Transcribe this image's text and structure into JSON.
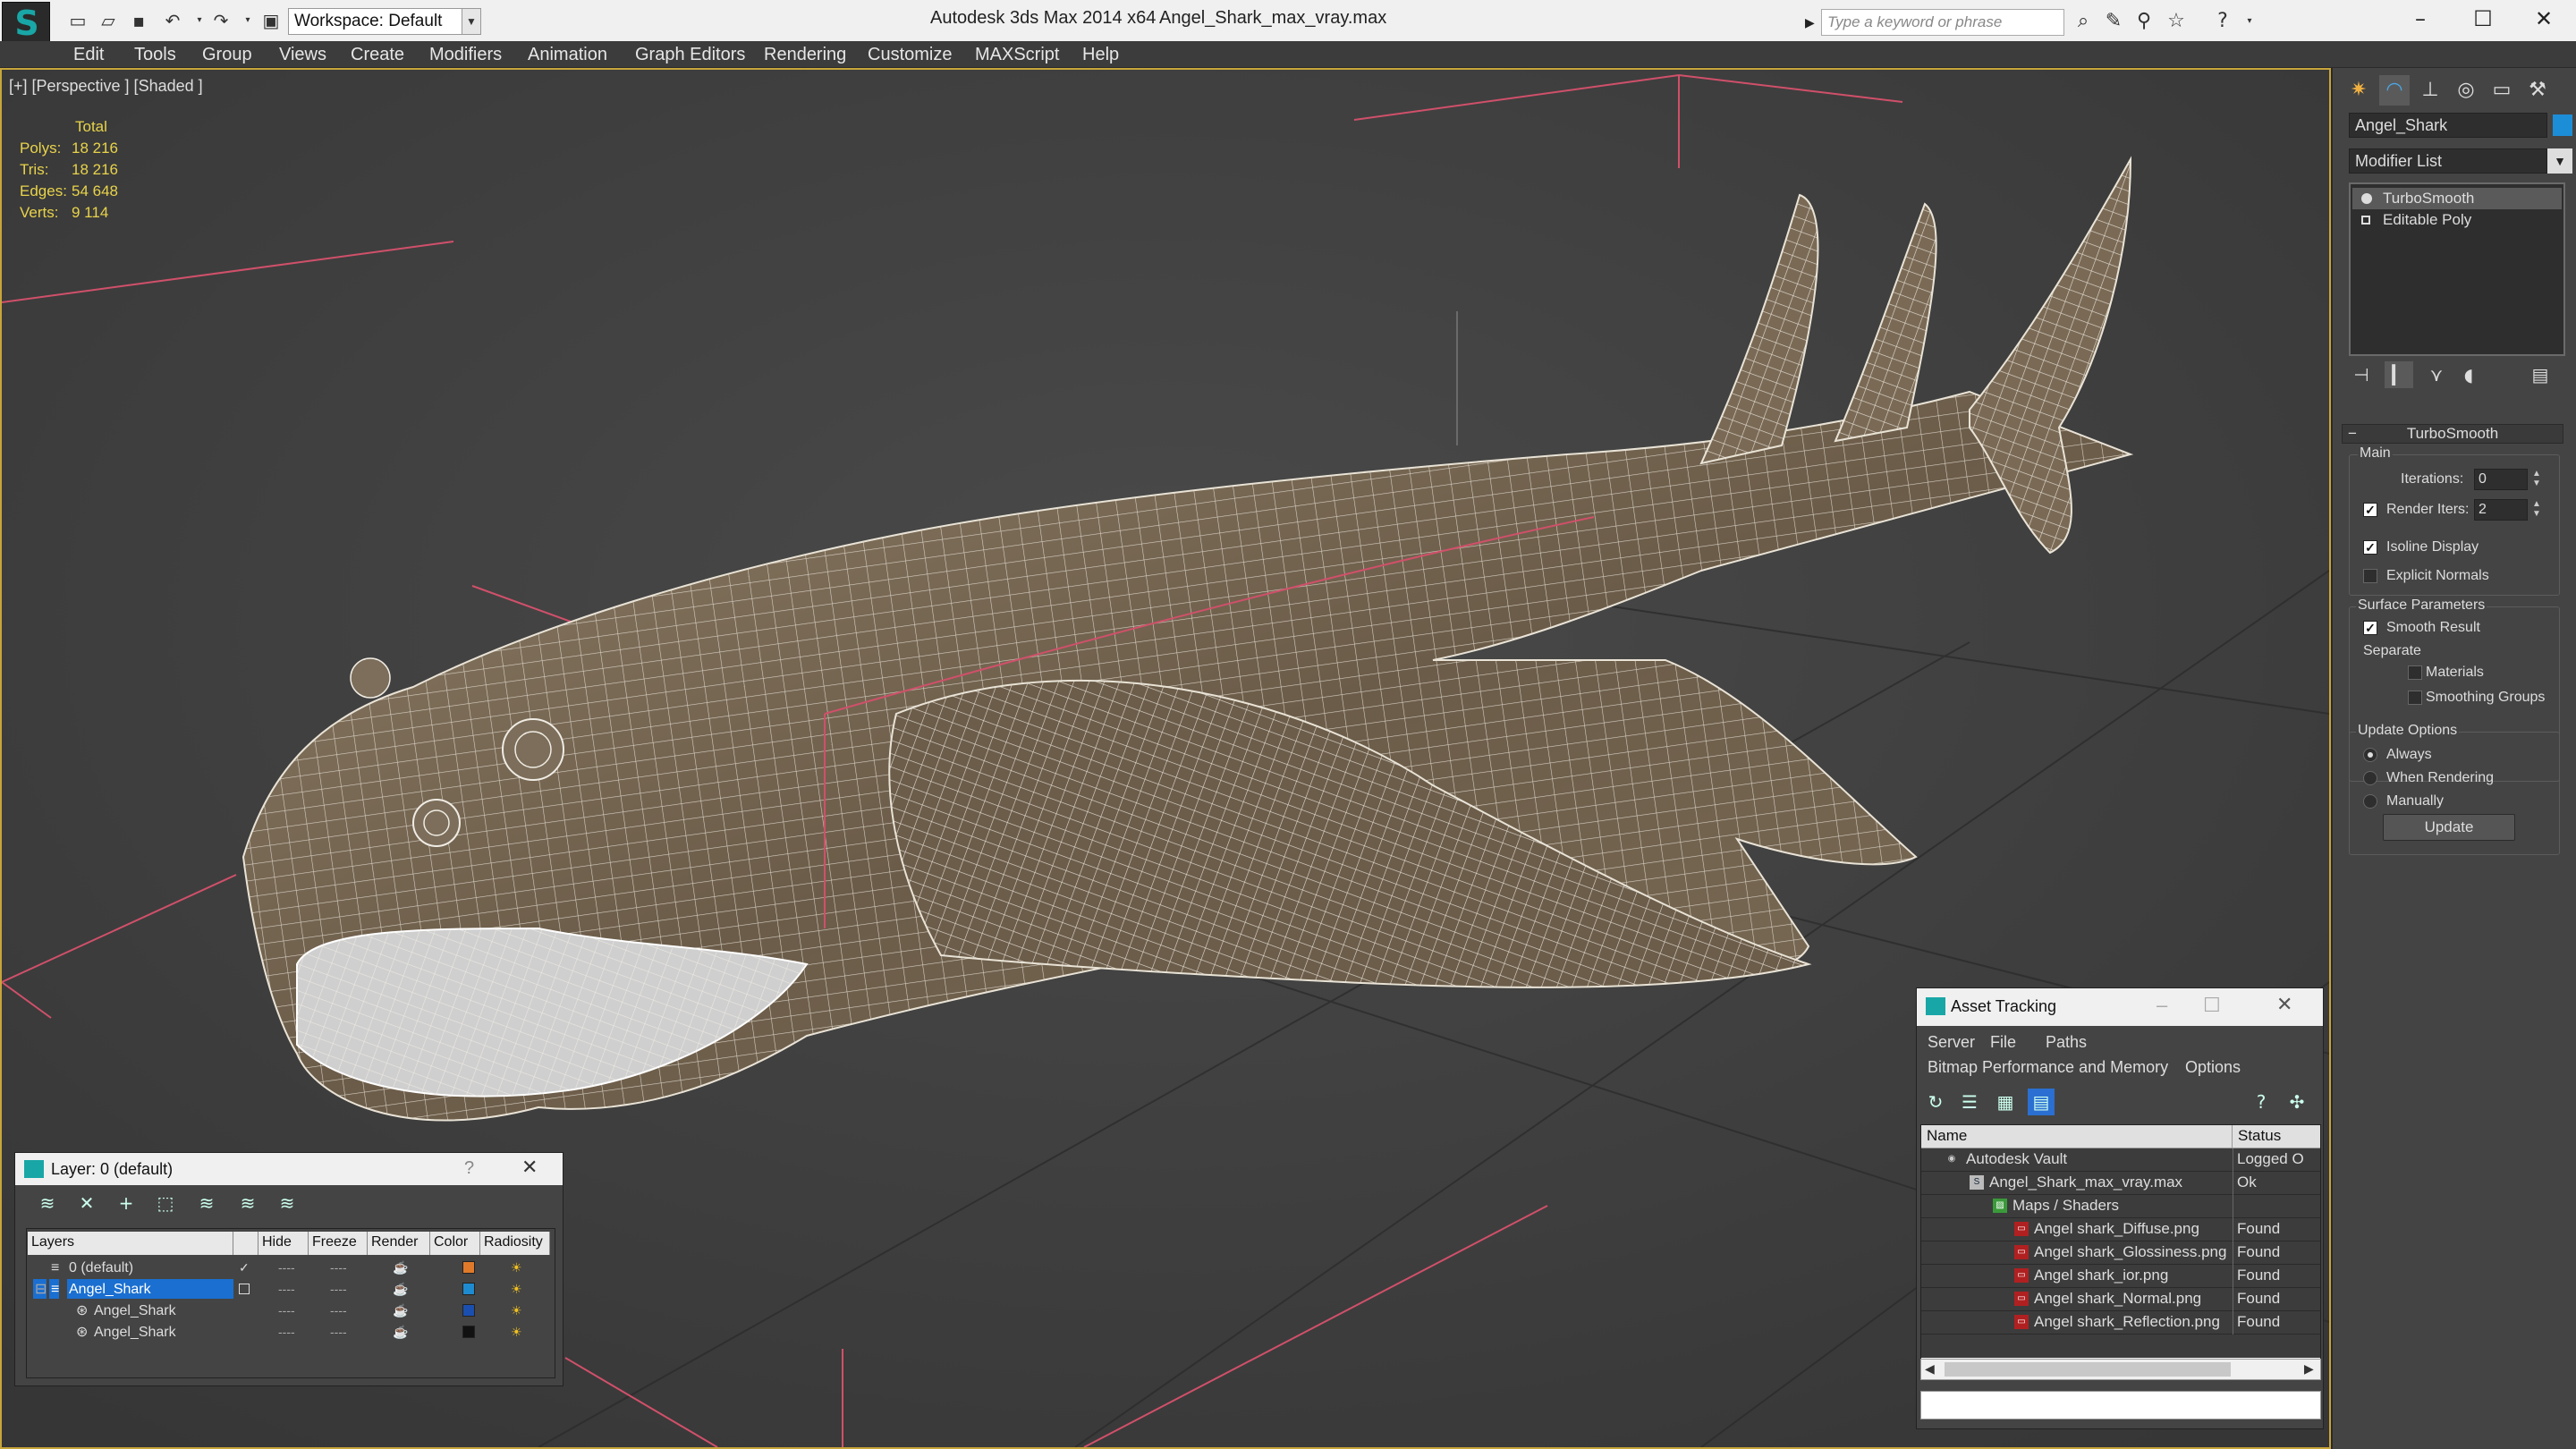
{
  "titlebar": {
    "workspace_label": "Workspace: Default",
    "app_title": "Autodesk 3ds Max  2014 x64",
    "file_title": "Angel_Shark_max_vray.max",
    "search_placeholder": "Type a keyword or phrase"
  },
  "menu": [
    "Edit",
    "Tools",
    "Group",
    "Views",
    "Create",
    "Modifiers",
    "Animation",
    "Graph Editors",
    "Rendering",
    "Customize",
    "MAXScript",
    "Help"
  ],
  "viewport": {
    "label": "[+] [Perspective ] [Shaded ]",
    "stats": {
      "header": "Total",
      "rows": [
        {
          "label": "Polys:",
          "value": "18 216"
        },
        {
          "label": "Tris:",
          "value": "18 216"
        },
        {
          "label": "Edges:",
          "value": "54 648"
        },
        {
          "label": "Verts:",
          "value": "9 114"
        }
      ]
    }
  },
  "command_panel": {
    "object_name": "Angel_Shark",
    "object_color": "#1c8ed8",
    "modifier_list": "Modifier List",
    "stack": [
      "TurboSmooth",
      "Editable Poly"
    ],
    "turbosmooth": {
      "title": "TurboSmooth",
      "main_label": "Main",
      "iterations_label": "Iterations:",
      "iterations_value": "0",
      "render_iters_label": "Render Iters:",
      "render_iters_value": "2",
      "isoline_label": "Isoline Display",
      "explicit_normals_label": "Explicit Normals",
      "surface_params_label": "Surface Parameters",
      "smooth_result_label": "Smooth Result",
      "separate_label": "Separate",
      "materials_label": "Materials",
      "smoothing_groups_label": "Smoothing Groups",
      "update_options_label": "Update Options",
      "always_label": "Always",
      "when_rendering_label": "When Rendering",
      "manually_label": "Manually",
      "update_button": "Update"
    }
  },
  "layer_dialog": {
    "title": "Layer: 0 (default)",
    "help": "?",
    "columns": [
      "Layers",
      "Hide",
      "Freeze",
      "Render",
      "Color",
      "Radiosity"
    ],
    "rows": [
      {
        "name": "0 (default)",
        "color": "#e07a2a"
      },
      {
        "name": "Angel_Shark",
        "color": "#1e8bd0"
      },
      {
        "name": "Angel_Shark",
        "color": "#1a4fb0"
      },
      {
        "name": "Angel_Shark",
        "color": "#111111"
      }
    ]
  },
  "asset_dialog": {
    "title": "Asset Tracking",
    "menu1": [
      "Server",
      "File",
      "Paths"
    ],
    "menu2": [
      "Bitmap Performance and Memory",
      "Options"
    ],
    "columns": [
      "Name",
      "Status"
    ],
    "rows": [
      {
        "name": "Autodesk Vault",
        "status": "Logged O"
      },
      {
        "name": "Angel_Shark_max_vray.max",
        "status": "Ok"
      },
      {
        "name": "Maps / Shaders",
        "status": ""
      },
      {
        "name": "Angel shark_Diffuse.png",
        "status": "Found"
      },
      {
        "name": "Angel shark_Glossiness.png",
        "status": "Found"
      },
      {
        "name": "Angel shark_ior.png",
        "status": "Found"
      },
      {
        "name": "Angel shark_Normal.png",
        "status": "Found"
      },
      {
        "name": "Angel shark_Reflection.png",
        "status": "Found"
      }
    ]
  }
}
